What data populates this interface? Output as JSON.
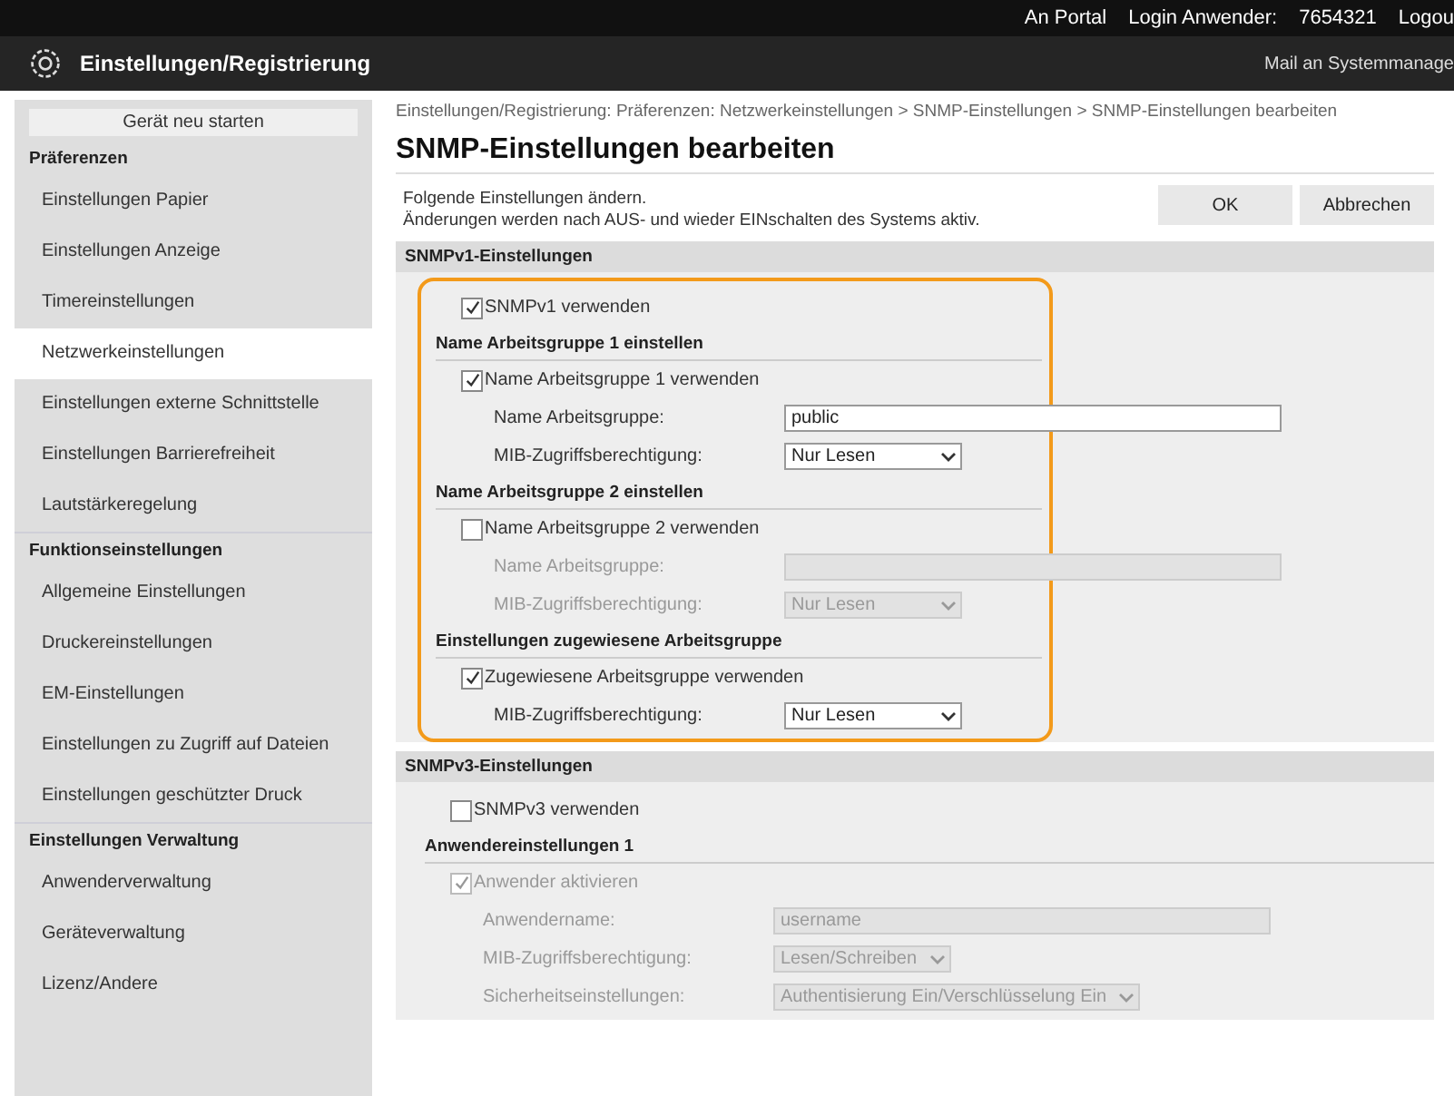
{
  "top_bar": {
    "portal_link": "An Portal",
    "login_label": "Login Anwender:",
    "login_id": "7654321",
    "logout_link": "Logou"
  },
  "header": {
    "title": "Einstellungen/Registrierung",
    "mail_link": "Mail an Systemmanage"
  },
  "sidebar": {
    "restart_button": "Gerät neu starten",
    "items": [
      {
        "kind": "heading",
        "label": "Präferenzen"
      },
      {
        "kind": "link",
        "label": "Einstellungen Papier",
        "selected": false
      },
      {
        "kind": "link",
        "label": "Einstellungen Anzeige",
        "selected": false
      },
      {
        "kind": "link",
        "label": "Timereinstellungen",
        "selected": false
      },
      {
        "kind": "link",
        "label": "Netzwerkeinstellungen",
        "selected": true
      },
      {
        "kind": "link",
        "label": "Einstellungen externe Schnittstelle",
        "selected": false
      },
      {
        "kind": "link",
        "label": "Einstellungen Barrierefreiheit",
        "selected": false
      },
      {
        "kind": "link",
        "label": "Lautstärkeregelung",
        "selected": false
      },
      {
        "kind": "heading",
        "label": "Funktionseinstellungen"
      },
      {
        "kind": "link",
        "label": "Allgemeine Einstellungen",
        "selected": false
      },
      {
        "kind": "link",
        "label": "Druckereinstellungen",
        "selected": false
      },
      {
        "kind": "link",
        "label": "EM-Einstellungen",
        "selected": false
      },
      {
        "kind": "link",
        "label": "Einstellungen zu Zugriff auf Dateien",
        "selected": false
      },
      {
        "kind": "link",
        "label": "Einstellungen geschützter Druck",
        "selected": false
      },
      {
        "kind": "heading",
        "label": "Einstellungen Verwaltung"
      },
      {
        "kind": "link",
        "label": "Anwenderverwaltung",
        "selected": false
      },
      {
        "kind": "link",
        "label": "Geräteverwaltung",
        "selected": false
      },
      {
        "kind": "link",
        "label": "Lizenz/Andere",
        "selected": false
      }
    ]
  },
  "main": {
    "breadcrumb": "Einstellungen/Registrierung: Präferenzen: Netzwerkeinstellungen > SNMP-Einstellungen > SNMP-Einstellungen bearbeiten",
    "title": "SNMP-Einstellungen bearbeiten",
    "description": [
      "Folgende Einstellungen ändern.",
      "Änderungen werden nach AUS- und wieder EINschalten des Systems aktiv."
    ],
    "buttons": [
      "OK",
      "Abbrechen"
    ],
    "sections": [
      {
        "title": "SNMPv1-Einstellungen",
        "highlighted": true,
        "rows": [
          {
            "kind": "checkbox",
            "label": "SNMPv1 verwenden",
            "checked": true,
            "disabled": false
          },
          {
            "kind": "heading",
            "label": "Name Arbeitsgruppe 1 einstellen"
          },
          {
            "kind": "checkbox",
            "label": "Name Arbeitsgruppe 1 verwenden",
            "checked": true,
            "disabled": false,
            "children": [
              {
                "kind": "text",
                "label": "Name Arbeitsgruppe:",
                "value": "public",
                "disabled": false
              },
              {
                "kind": "select",
                "label": "MIB-Zugriffsberechtigung:",
                "value": "Nur Lesen",
                "disabled": false
              }
            ]
          },
          {
            "kind": "heading",
            "label": "Name Arbeitsgruppe 2 einstellen"
          },
          {
            "kind": "checkbox",
            "label": "Name Arbeitsgruppe 2 verwenden",
            "checked": false,
            "disabled": false,
            "children": [
              {
                "kind": "text",
                "label": "Name Arbeitsgruppe:",
                "disabled": true
              },
              {
                "kind": "select",
                "label": "MIB-Zugriffsberechtigung:",
                "value": "Nur Lesen",
                "disabled": true
              }
            ]
          },
          {
            "kind": "heading",
            "label": "Einstellungen zugewiesene Arbeitsgruppe"
          },
          {
            "kind": "checkbox",
            "label": "Zugewiesene Arbeitsgruppe verwenden",
            "checked": true,
            "disabled": false,
            "children": [
              {
                "kind": "select",
                "label": "MIB-Zugriffsberechtigung:",
                "value": "Nur Lesen",
                "disabled": false
              }
            ]
          }
        ]
      },
      {
        "title": "SNMPv3-Einstellungen",
        "rows": [
          {
            "kind": "checkbox",
            "label": "SNMPv3 verwenden",
            "checked": false,
            "disabled": false
          },
          {
            "kind": "heading",
            "label": "Anwendereinstellungen 1"
          },
          {
            "kind": "checkbox",
            "label": "Anwender aktivieren",
            "checked": true,
            "disabled": true,
            "children": [
              {
                "kind": "text",
                "label": "Anwendername:",
                "value": "username",
                "disabled": true
              },
              {
                "kind": "select",
                "label": "MIB-Zugriffsberechtigung:",
                "value": "Lesen/Schreiben",
                "disabled": true
              },
              {
                "kind": "select",
                "label": "Sicherheitseinstellungen:",
                "value": "Authentisierung Ein/Verschlüsselung Ein",
                "disabled": true
              }
            ]
          }
        ]
      }
    ]
  }
}
